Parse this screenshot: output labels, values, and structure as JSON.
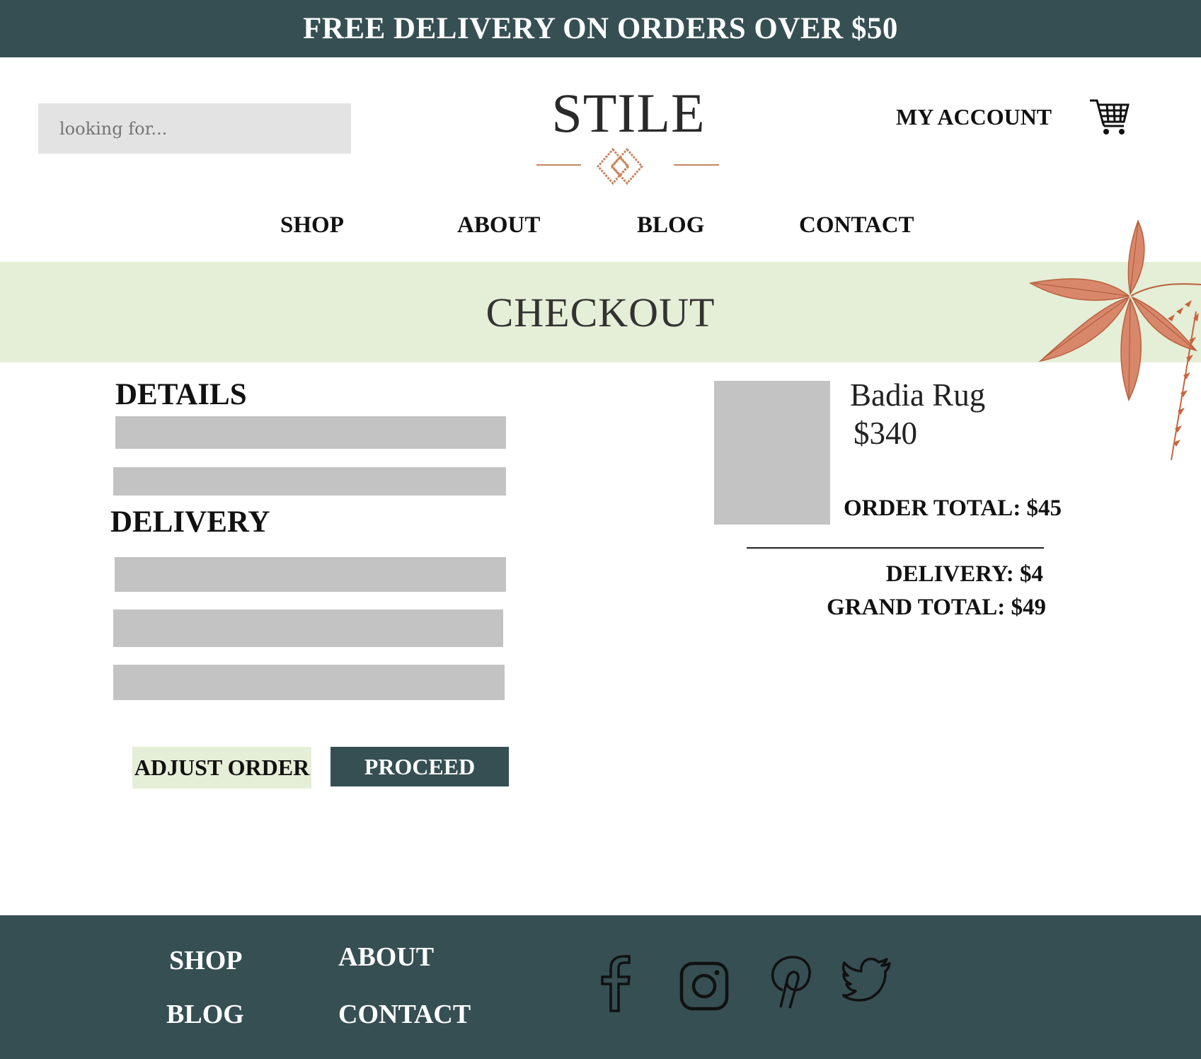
{
  "promo": {
    "text": "FREE DELIVERY ON ORDERS OVER $50"
  },
  "header": {
    "search_placeholder": "looking for...",
    "logo_text": "STILE",
    "account_label": "MY ACCOUNT"
  },
  "nav": {
    "items": [
      {
        "label": "SHOP"
      },
      {
        "label": "ABOUT"
      },
      {
        "label": "BLOG"
      },
      {
        "label": "CONTACT"
      }
    ]
  },
  "banner": {
    "title": "CHECKOUT"
  },
  "form": {
    "details_heading": "DETAILS",
    "delivery_heading": "DELIVERY",
    "adjust_button": "ADJUST ORDER",
    "proceed_button": "PROCEED"
  },
  "summary": {
    "product_name": "Badia Rug",
    "product_price": "$340",
    "order_total": "ORDER TOTAL: $45",
    "delivery": "DELIVERY: $4",
    "grand_total": "GRAND TOTAL: $49"
  },
  "footer": {
    "links": [
      {
        "label": "SHOP"
      },
      {
        "label": "ABOUT"
      },
      {
        "label": "BLOG"
      },
      {
        "label": "CONTACT"
      }
    ],
    "social_icons": [
      "facebook-icon",
      "instagram-icon",
      "pinterest-icon",
      "twitter-icon"
    ]
  },
  "colors": {
    "dark_teal": "#364f53",
    "pale_green": "#e5eed7",
    "placeholder_gray": "#c3c3c3",
    "copper": "#c98560"
  }
}
